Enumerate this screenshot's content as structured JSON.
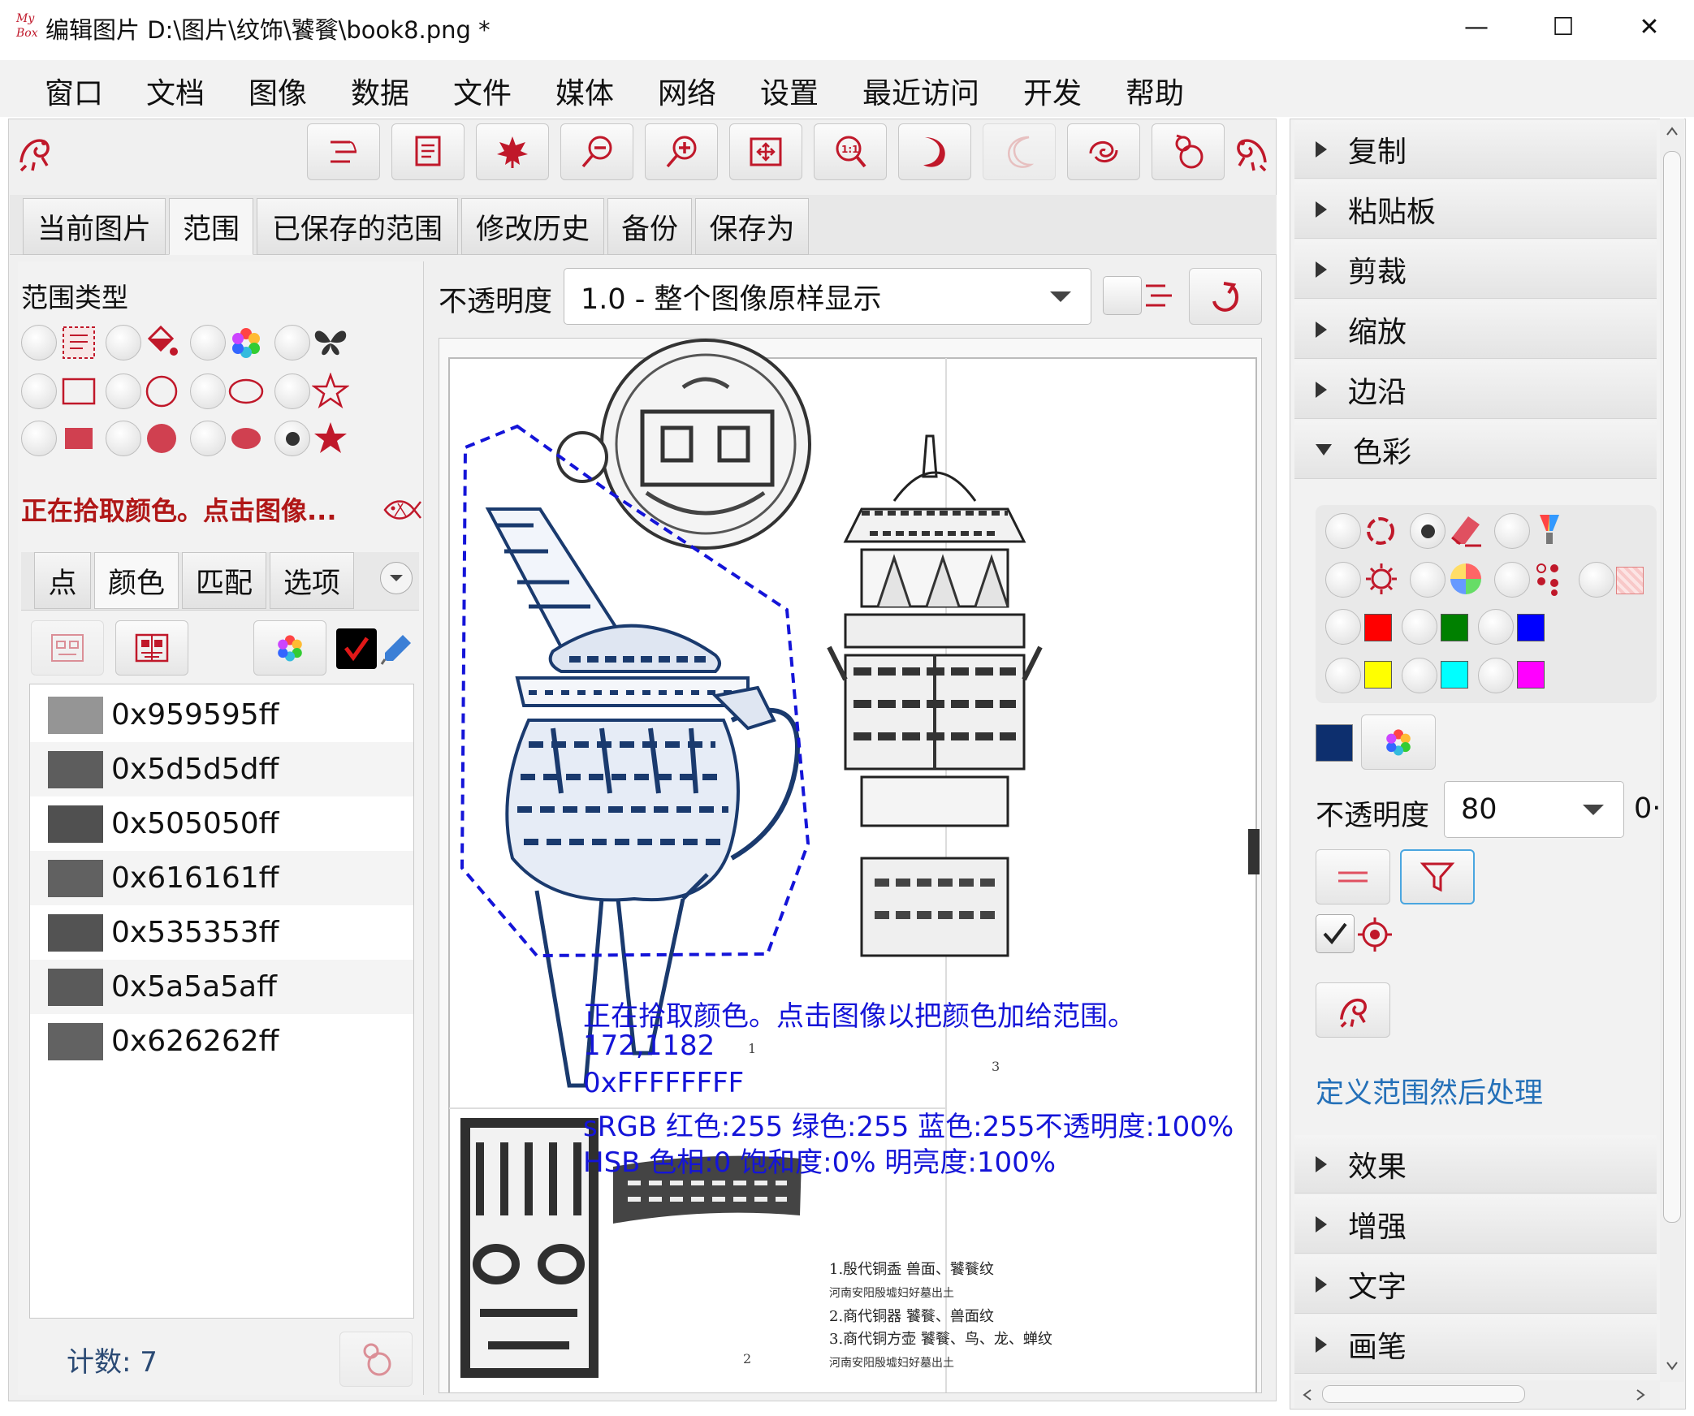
{
  "window": {
    "title": "编辑图片 D:\\图片\\纹饰\\饕餮\\book8.png  *",
    "minimize_glyph": "—",
    "maximize_glyph": "☐",
    "close_glyph": "✕"
  },
  "menu": [
    "窗口",
    "文档",
    "图像",
    "数据",
    "文件",
    "媒体",
    "网络",
    "设置",
    "最近访问",
    "开发",
    "帮助"
  ],
  "toolbar_icons": [
    "bars-icon",
    "doc-icon",
    "maple-leaf-icon",
    "zoom-out-icon",
    "zoom-in-icon",
    "fit-window-icon",
    "actual-size-icon",
    "rotate-left-icon",
    "rotate-right-icon",
    "swirl-icon",
    "gourd-icon"
  ],
  "tabs": [
    "当前图片",
    "范围",
    "已保存的范围",
    "修改历史",
    "备份",
    "保存为"
  ],
  "scope": {
    "type_label": "范围类型",
    "status": "正在拾取颜色。点击图像..."
  },
  "subtabs": [
    "点",
    "颜色",
    "匹配",
    "选项"
  ],
  "colors": [
    {
      "hex": "0x959595ff",
      "swatch": "#959595"
    },
    {
      "hex": "0x5d5d5dff",
      "swatch": "#5d5d5d"
    },
    {
      "hex": "0x505050ff",
      "swatch": "#505050"
    },
    {
      "hex": "0x616161ff",
      "swatch": "#616161"
    },
    {
      "hex": "0x535353ff",
      "swatch": "#535353"
    },
    {
      "hex": "0x5a5a5aff",
      "swatch": "#5a5a5a"
    },
    {
      "hex": "0x626262ff",
      "swatch": "#626262"
    }
  ],
  "count_label": "计数: 7",
  "opacity": {
    "label": "不透明度",
    "value": "1.0 - 整个图像原样显示"
  },
  "overlay": {
    "line1": "正在拾取颜色。点击图像以把颜色加给范围。",
    "line2": "172,1182",
    "line3": "0xFFFFFFFF",
    "line4": "sRGB  红色:255 绿色:255 蓝色:255不透明度:100%",
    "line5": "HSB  色相:0 饱和度:0% 明亮度:100%"
  },
  "page_numbers": [
    "1",
    "2",
    "3"
  ],
  "caption_lines": [
    "1.殷代铜盉   兽面、饕餮纹",
    "河南安阳殷墟妇好墓出土",
    "2.商代铜器   饕餮、兽面纹",
    "3.商代铜方壶   饕餮、鸟、龙、蝉纹",
    "河南安阳殷墟妇好墓出土"
  ],
  "right_panel": {
    "sections_top": [
      "复制",
      "粘贴板",
      "剪裁",
      "缩放",
      "边沿",
      "色彩"
    ],
    "sections_bottom": [
      "效果",
      "增强",
      "文字",
      "画笔"
    ],
    "opacity_label": "不透明度",
    "opacity_value": "80",
    "opacity_extra": "0·",
    "link": "定义范围然后处理",
    "current_color": "#0d2f6e"
  },
  "accent_color": "#c0182a"
}
